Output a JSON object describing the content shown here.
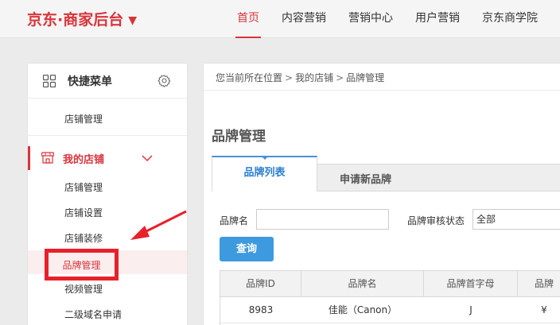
{
  "header": {
    "logo": "京东·商家后台",
    "logo_caret": "▼",
    "nav": [
      {
        "label": "首页",
        "active": true
      },
      {
        "label": "内容营销"
      },
      {
        "label": "营销中心"
      },
      {
        "label": "用户营销"
      },
      {
        "label": "京东商学院"
      }
    ]
  },
  "sidebar": {
    "quick_title": "快捷菜单",
    "quick_item": "店铺管理",
    "shop_title": "我的店铺",
    "shop_items": [
      "店铺管理",
      "店铺设置",
      "店铺装修",
      "品牌管理",
      "视频管理",
      "二级域名申请"
    ],
    "selected_item": "品牌管理"
  },
  "breadcrumb": {
    "prefix": "您当前所在位置",
    "sep": ">",
    "level1": "我的店铺",
    "level2": "品牌管理"
  },
  "page": {
    "title": "品牌管理",
    "tabs": [
      "品牌列表",
      "申请新品牌"
    ],
    "filters": {
      "brand_name_label": "品牌名",
      "brand_name_value": "",
      "status_label": "品牌审核状态",
      "status_value": "全部"
    },
    "query_button": "查询"
  },
  "table": {
    "headers": [
      "品牌ID",
      "品牌名",
      "品牌首字母",
      "品牌"
    ],
    "rows": [
      [
        "8983",
        "佳能（Canon）",
        "J",
        "¥"
      ]
    ]
  },
  "colors": {
    "brand_red": "#d9343b",
    "tab_blue": "#2a7ecf",
    "button_blue": "#3d9ade",
    "annotation_red": "#e8202a"
  }
}
